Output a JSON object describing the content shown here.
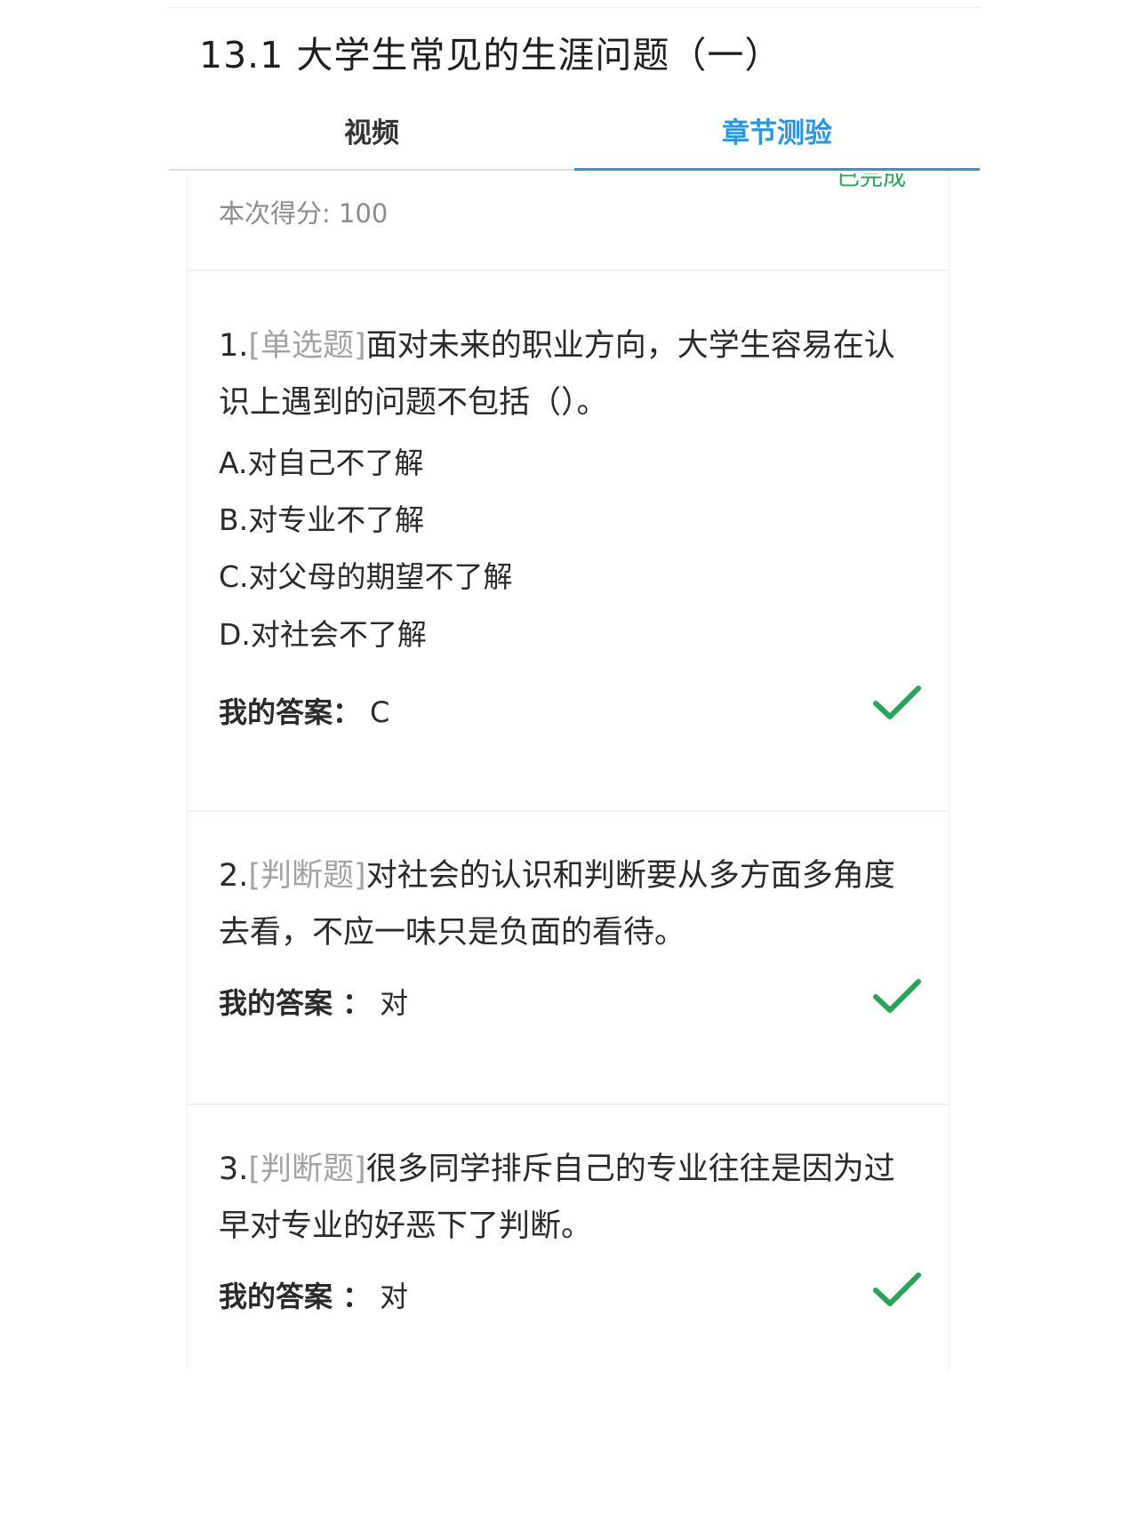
{
  "header": {
    "title": "13.1 大学生常见的生涯问题（一）"
  },
  "tabs": [
    {
      "label": "视频",
      "active": false
    },
    {
      "label": "章节测验",
      "active": true
    }
  ],
  "score": {
    "text": "本次得分: 100",
    "status": "已完成"
  },
  "questions": [
    {
      "number": "1.",
      "type": "[单选题]",
      "text": "面对未来的职业方向，大学生容易在认识上遇到的问题不包括（）。",
      "options": [
        "A.对自己不了解",
        "B.对专业不了解",
        "C.对父母的期望不了解",
        "D.对社会不了解"
      ],
      "answer_label": "我的答案：",
      "answer": "C",
      "result_icon": "check-icon"
    },
    {
      "number": "2.",
      "type": "[判断题]",
      "text": "对社会的认识和判断要从多方面多角度去看，不应一味只是负面的看待。",
      "answer_label": "我的答案 ：",
      "answer": "对",
      "result_icon": "check-icon"
    },
    {
      "number": "3.",
      "type": "[判断题]",
      "text": "很多同学排斥自己的专业往往是因为过早对专业的好恶下了判断。",
      "answer_label": "我的答案 ：",
      "answer": "对",
      "result_icon": "check-icon"
    }
  ],
  "colors": {
    "accent": "#2b96e0",
    "correct": "#2ba35b",
    "type_label": "#a3a3a3"
  }
}
